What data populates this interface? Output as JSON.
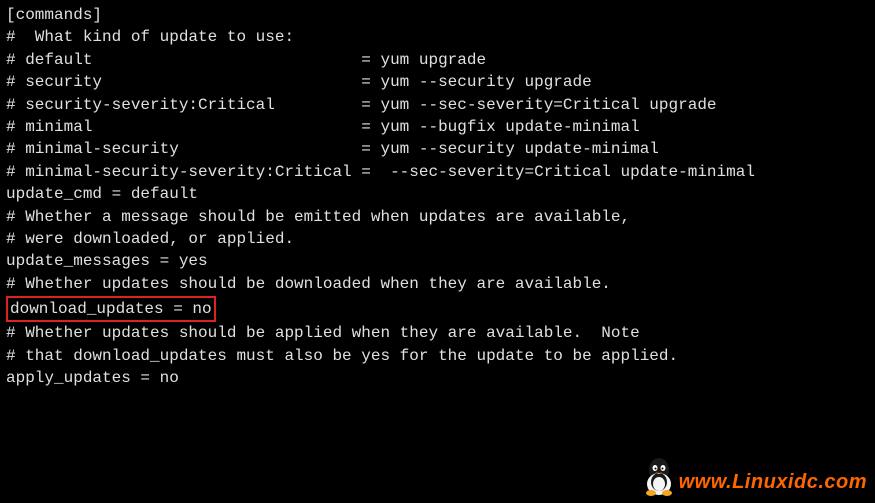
{
  "lines": [
    "[commands]",
    "#  What kind of update to use:",
    "# default                            = yum upgrade",
    "# security                           = yum --security upgrade",
    "# security-severity:Critical         = yum --sec-severity=Critical upgrade",
    "# minimal                            = yum --bugfix update-minimal",
    "# minimal-security                   = yum --security update-minimal",
    "# minimal-security-severity:Critical =  --sec-severity=Critical update-minimal",
    "update_cmd = default",
    "",
    "# Whether a message should be emitted when updates are available,",
    "# were downloaded, or applied.",
    "update_messages = yes",
    "",
    "# Whether updates should be downloaded when they are available."
  ],
  "highlighted_line": "download_updates = no",
  "lines_after": [
    "",
    "# Whether updates should be applied when they are available.  Note",
    "# that download_updates must also be yes for the update to be applied.",
    "apply_updates = no"
  ],
  "watermark": {
    "text": "www.Linuxidc.com"
  }
}
